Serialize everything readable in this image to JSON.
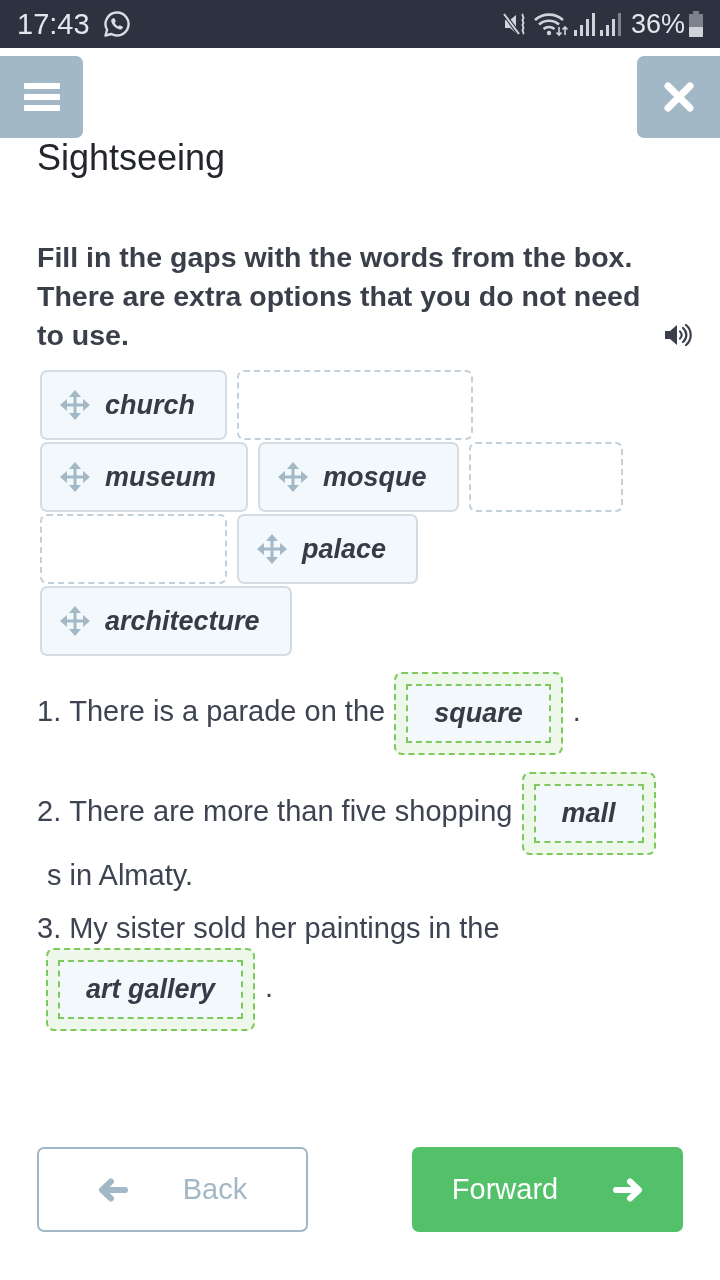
{
  "status_bar": {
    "time": "17:43",
    "battery": "36%"
  },
  "header": {
    "title": "Sightseeing"
  },
  "task": {
    "instruction": "Fill in the gaps with the words from the box. There are extra options that you do not need to use."
  },
  "word_bank": [
    {
      "kind": "word",
      "text": "church"
    },
    {
      "kind": "slot"
    },
    {
      "kind": "word",
      "text": "museum"
    },
    {
      "kind": "word",
      "text": "mosque"
    },
    {
      "kind": "slot"
    },
    {
      "kind": "slot"
    },
    {
      "kind": "word",
      "text": "palace"
    },
    {
      "kind": "word",
      "text": "architecture"
    }
  ],
  "sentences": [
    {
      "number": "1.",
      "parts": [
        {
          "kind": "text",
          "text": "There is a parade on the"
        },
        {
          "kind": "gap",
          "answer": "square"
        },
        {
          "kind": "text",
          "text": "."
        }
      ]
    },
    {
      "number": "2.",
      "parts": [
        {
          "kind": "text",
          "text": "There are more than five shopping"
        },
        {
          "kind": "gap",
          "answer": "mall"
        },
        {
          "kind": "text",
          "text": "s in Almaty."
        }
      ]
    },
    {
      "number": "3.",
      "parts": [
        {
          "kind": "text",
          "text": "My sister sold her paintings in the"
        },
        {
          "kind": "gap",
          "answer": "art gallery"
        },
        {
          "kind": "text",
          "text": "."
        }
      ]
    }
  ],
  "buttons": {
    "back": "Back",
    "forward": "Forward"
  }
}
